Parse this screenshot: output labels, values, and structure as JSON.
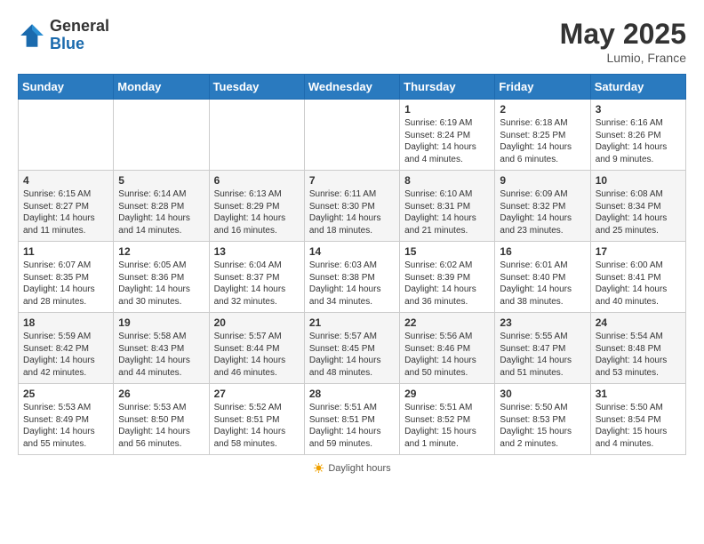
{
  "header": {
    "logo_general": "General",
    "logo_blue": "Blue",
    "month_year": "May 2025",
    "location": "Lumio, France"
  },
  "days_of_week": [
    "Sunday",
    "Monday",
    "Tuesday",
    "Wednesday",
    "Thursday",
    "Friday",
    "Saturday"
  ],
  "weeks": [
    [
      {
        "day": "",
        "info": ""
      },
      {
        "day": "",
        "info": ""
      },
      {
        "day": "",
        "info": ""
      },
      {
        "day": "",
        "info": ""
      },
      {
        "day": "1",
        "info": "Sunrise: 6:19 AM\nSunset: 8:24 PM\nDaylight: 14 hours\nand 4 minutes."
      },
      {
        "day": "2",
        "info": "Sunrise: 6:18 AM\nSunset: 8:25 PM\nDaylight: 14 hours\nand 6 minutes."
      },
      {
        "day": "3",
        "info": "Sunrise: 6:16 AM\nSunset: 8:26 PM\nDaylight: 14 hours\nand 9 minutes."
      }
    ],
    [
      {
        "day": "4",
        "info": "Sunrise: 6:15 AM\nSunset: 8:27 PM\nDaylight: 14 hours\nand 11 minutes."
      },
      {
        "day": "5",
        "info": "Sunrise: 6:14 AM\nSunset: 8:28 PM\nDaylight: 14 hours\nand 14 minutes."
      },
      {
        "day": "6",
        "info": "Sunrise: 6:13 AM\nSunset: 8:29 PM\nDaylight: 14 hours\nand 16 minutes."
      },
      {
        "day": "7",
        "info": "Sunrise: 6:11 AM\nSunset: 8:30 PM\nDaylight: 14 hours\nand 18 minutes."
      },
      {
        "day": "8",
        "info": "Sunrise: 6:10 AM\nSunset: 8:31 PM\nDaylight: 14 hours\nand 21 minutes."
      },
      {
        "day": "9",
        "info": "Sunrise: 6:09 AM\nSunset: 8:32 PM\nDaylight: 14 hours\nand 23 minutes."
      },
      {
        "day": "10",
        "info": "Sunrise: 6:08 AM\nSunset: 8:34 PM\nDaylight: 14 hours\nand 25 minutes."
      }
    ],
    [
      {
        "day": "11",
        "info": "Sunrise: 6:07 AM\nSunset: 8:35 PM\nDaylight: 14 hours\nand 28 minutes."
      },
      {
        "day": "12",
        "info": "Sunrise: 6:05 AM\nSunset: 8:36 PM\nDaylight: 14 hours\nand 30 minutes."
      },
      {
        "day": "13",
        "info": "Sunrise: 6:04 AM\nSunset: 8:37 PM\nDaylight: 14 hours\nand 32 minutes."
      },
      {
        "day": "14",
        "info": "Sunrise: 6:03 AM\nSunset: 8:38 PM\nDaylight: 14 hours\nand 34 minutes."
      },
      {
        "day": "15",
        "info": "Sunrise: 6:02 AM\nSunset: 8:39 PM\nDaylight: 14 hours\nand 36 minutes."
      },
      {
        "day": "16",
        "info": "Sunrise: 6:01 AM\nSunset: 8:40 PM\nDaylight: 14 hours\nand 38 minutes."
      },
      {
        "day": "17",
        "info": "Sunrise: 6:00 AM\nSunset: 8:41 PM\nDaylight: 14 hours\nand 40 minutes."
      }
    ],
    [
      {
        "day": "18",
        "info": "Sunrise: 5:59 AM\nSunset: 8:42 PM\nDaylight: 14 hours\nand 42 minutes."
      },
      {
        "day": "19",
        "info": "Sunrise: 5:58 AM\nSunset: 8:43 PM\nDaylight: 14 hours\nand 44 minutes."
      },
      {
        "day": "20",
        "info": "Sunrise: 5:57 AM\nSunset: 8:44 PM\nDaylight: 14 hours\nand 46 minutes."
      },
      {
        "day": "21",
        "info": "Sunrise: 5:57 AM\nSunset: 8:45 PM\nDaylight: 14 hours\nand 48 minutes."
      },
      {
        "day": "22",
        "info": "Sunrise: 5:56 AM\nSunset: 8:46 PM\nDaylight: 14 hours\nand 50 minutes."
      },
      {
        "day": "23",
        "info": "Sunrise: 5:55 AM\nSunset: 8:47 PM\nDaylight: 14 hours\nand 51 minutes."
      },
      {
        "day": "24",
        "info": "Sunrise: 5:54 AM\nSunset: 8:48 PM\nDaylight: 14 hours\nand 53 minutes."
      }
    ],
    [
      {
        "day": "25",
        "info": "Sunrise: 5:53 AM\nSunset: 8:49 PM\nDaylight: 14 hours\nand 55 minutes."
      },
      {
        "day": "26",
        "info": "Sunrise: 5:53 AM\nSunset: 8:50 PM\nDaylight: 14 hours\nand 56 minutes."
      },
      {
        "day": "27",
        "info": "Sunrise: 5:52 AM\nSunset: 8:51 PM\nDaylight: 14 hours\nand 58 minutes."
      },
      {
        "day": "28",
        "info": "Sunrise: 5:51 AM\nSunset: 8:51 PM\nDaylight: 14 hours\nand 59 minutes."
      },
      {
        "day": "29",
        "info": "Sunrise: 5:51 AM\nSunset: 8:52 PM\nDaylight: 15 hours\nand 1 minute."
      },
      {
        "day": "30",
        "info": "Sunrise: 5:50 AM\nSunset: 8:53 PM\nDaylight: 15 hours\nand 2 minutes."
      },
      {
        "day": "31",
        "info": "Sunrise: 5:50 AM\nSunset: 8:54 PM\nDaylight: 15 hours\nand 4 minutes."
      }
    ]
  ],
  "footer": {
    "daylight_label": "Daylight hours"
  }
}
